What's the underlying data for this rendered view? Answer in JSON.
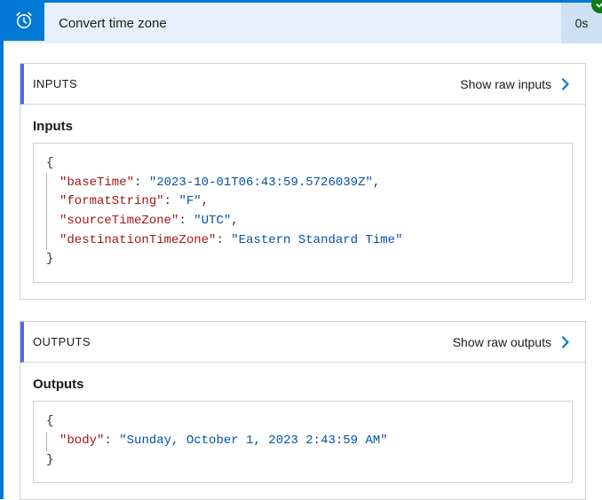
{
  "header": {
    "title": "Convert time zone",
    "duration": "0s",
    "icon": "alarm-clock-icon",
    "status_icon": "success-check-icon"
  },
  "inputs_panel": {
    "header": "INPUTS",
    "raw_link": "Show raw inputs",
    "body_title": "Inputs",
    "json": {
      "baseTime_key": "\"baseTime\"",
      "baseTime_val": "\"2023-10-01T06:43:59.5726039Z\"",
      "formatString_key": "\"formatString\"",
      "formatString_val": "\"F\"",
      "sourceTimeZone_key": "\"sourceTimeZone\"",
      "sourceTimeZone_val": "\"UTC\"",
      "destinationTimeZone_key": "\"destinationTimeZone\"",
      "destinationTimeZone_val": "\"Eastern Standard Time\""
    }
  },
  "outputs_panel": {
    "header": "OUTPUTS",
    "raw_link": "Show raw outputs",
    "body_title": "Outputs",
    "json": {
      "body_key": "\"body\"",
      "body_val": "\"Sunday, October 1, 2023 2:43:59 AM\""
    }
  }
}
